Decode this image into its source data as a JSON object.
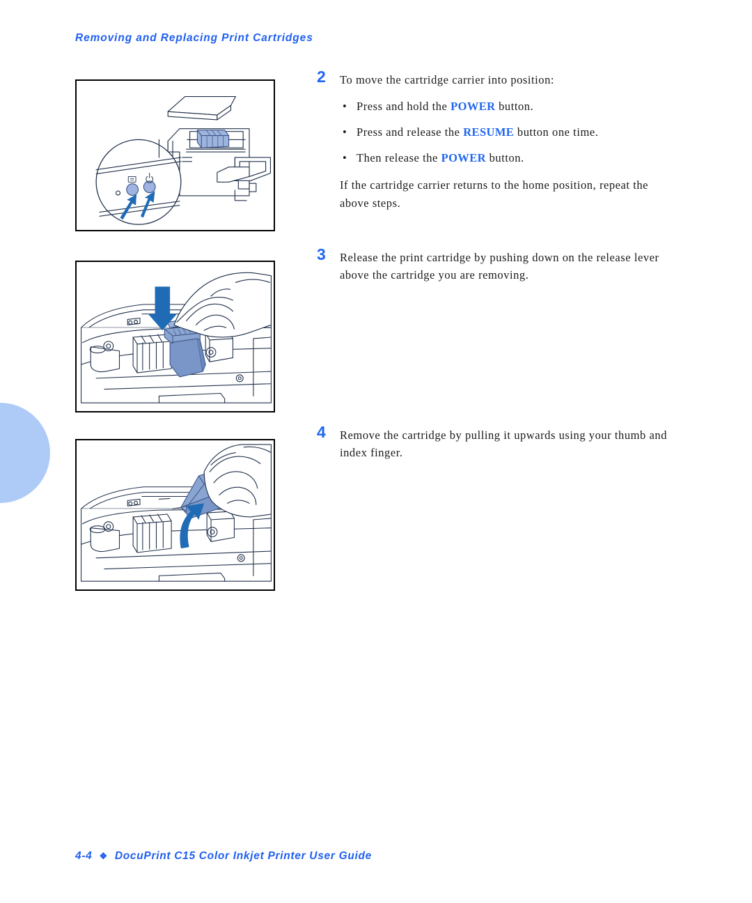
{
  "page": {
    "header": "Removing and Replacing Print Cartridges",
    "footer": {
      "page_number": "4-4",
      "diamond": "❖",
      "title": "DocuPrint C15 Color Inkjet Printer User Guide"
    },
    "accent_blue": "#1f66f0",
    "arrow_blue": "#1f6bb5",
    "cartridge_blue": "#7a96c8",
    "blob_blue": "#aecbf7"
  },
  "steps": [
    {
      "number": "2",
      "lead": "To move the cartridge carrier into position:",
      "bullets": [
        {
          "dot": "•",
          "pre": "Press and hold the ",
          "keyword": "POWER",
          "post": " button."
        },
        {
          "dot": "•",
          "pre": "Press and release the ",
          "keyword": "RESUME",
          "post": " button one time."
        },
        {
          "dot": "•",
          "pre": "Then release the ",
          "keyword": "POWER",
          "post": " button."
        }
      ],
      "trailing": "If the cartridge carrier returns to the home position, repeat the above steps."
    },
    {
      "number": "3",
      "lead": "Release the print cartridge by pushing down on the release lever above the cartridge you are removing.",
      "bullets": [],
      "trailing": ""
    },
    {
      "number": "4",
      "lead": "Remove the cartridge by pulling it upwards using your thumb and index finger.",
      "bullets": [],
      "trailing": ""
    }
  ],
  "figures": [
    {
      "id": "figure-printer-control-panel",
      "caption_alt": "Printer with open top cover and magnified view of the RESUME and POWER buttons with two upward arrows"
    },
    {
      "id": "figure-press-release-lever",
      "caption_alt": "Hand pushing down on the print cartridge release lever, downward arrow"
    },
    {
      "id": "figure-lift-cartridge",
      "caption_alt": "Hand lifting the print cartridge upwards out of the carrier, curved upward arrow"
    }
  ]
}
